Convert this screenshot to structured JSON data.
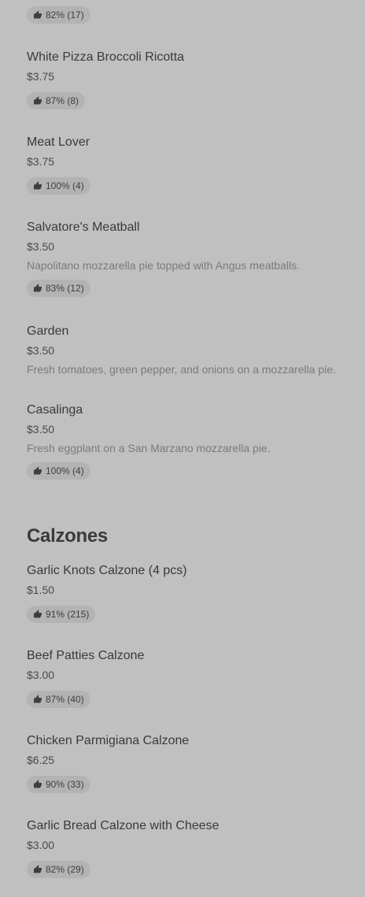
{
  "top_badge": "82% (17)",
  "items_a": [
    {
      "name": "White Pizza Broccoli Ricotta",
      "price": "$3.75",
      "badge": "87% (8)"
    },
    {
      "name": "Meat Lover",
      "price": "$3.75",
      "badge": "100% (4)"
    },
    {
      "name": "Salvatore's Meatball",
      "price": "$3.50",
      "desc": "Napolitano mozzarella pie topped with Angus meatballs.",
      "badge": "83% (12)"
    },
    {
      "name": "Garden",
      "price": "$3.50",
      "desc": "Fresh tomatoes, green pepper, and onions on a mozzarella pie."
    },
    {
      "name": "Casalinga",
      "price": "$3.50",
      "desc": "Fresh eggplant on a San Marzano mozzarella pie.",
      "badge": "100% (4)"
    }
  ],
  "calzones": {
    "title": "Calzones",
    "items": [
      {
        "name": "Garlic Knots Calzone (4 pcs)",
        "price": "$1.50",
        "badge": "91% (215)"
      },
      {
        "name": "Beef Patties Calzone",
        "price": "$3.00",
        "badge": "87% (40)"
      },
      {
        "name": "Chicken Parmigiana Calzone",
        "price": "$6.25",
        "badge": "90% (33)"
      },
      {
        "name": "Garlic Bread Calzone with Cheese",
        "price": "$3.00",
        "badge": "82% (29)"
      }
    ]
  },
  "icons": {
    "rating": "thumbs-up-icon"
  }
}
